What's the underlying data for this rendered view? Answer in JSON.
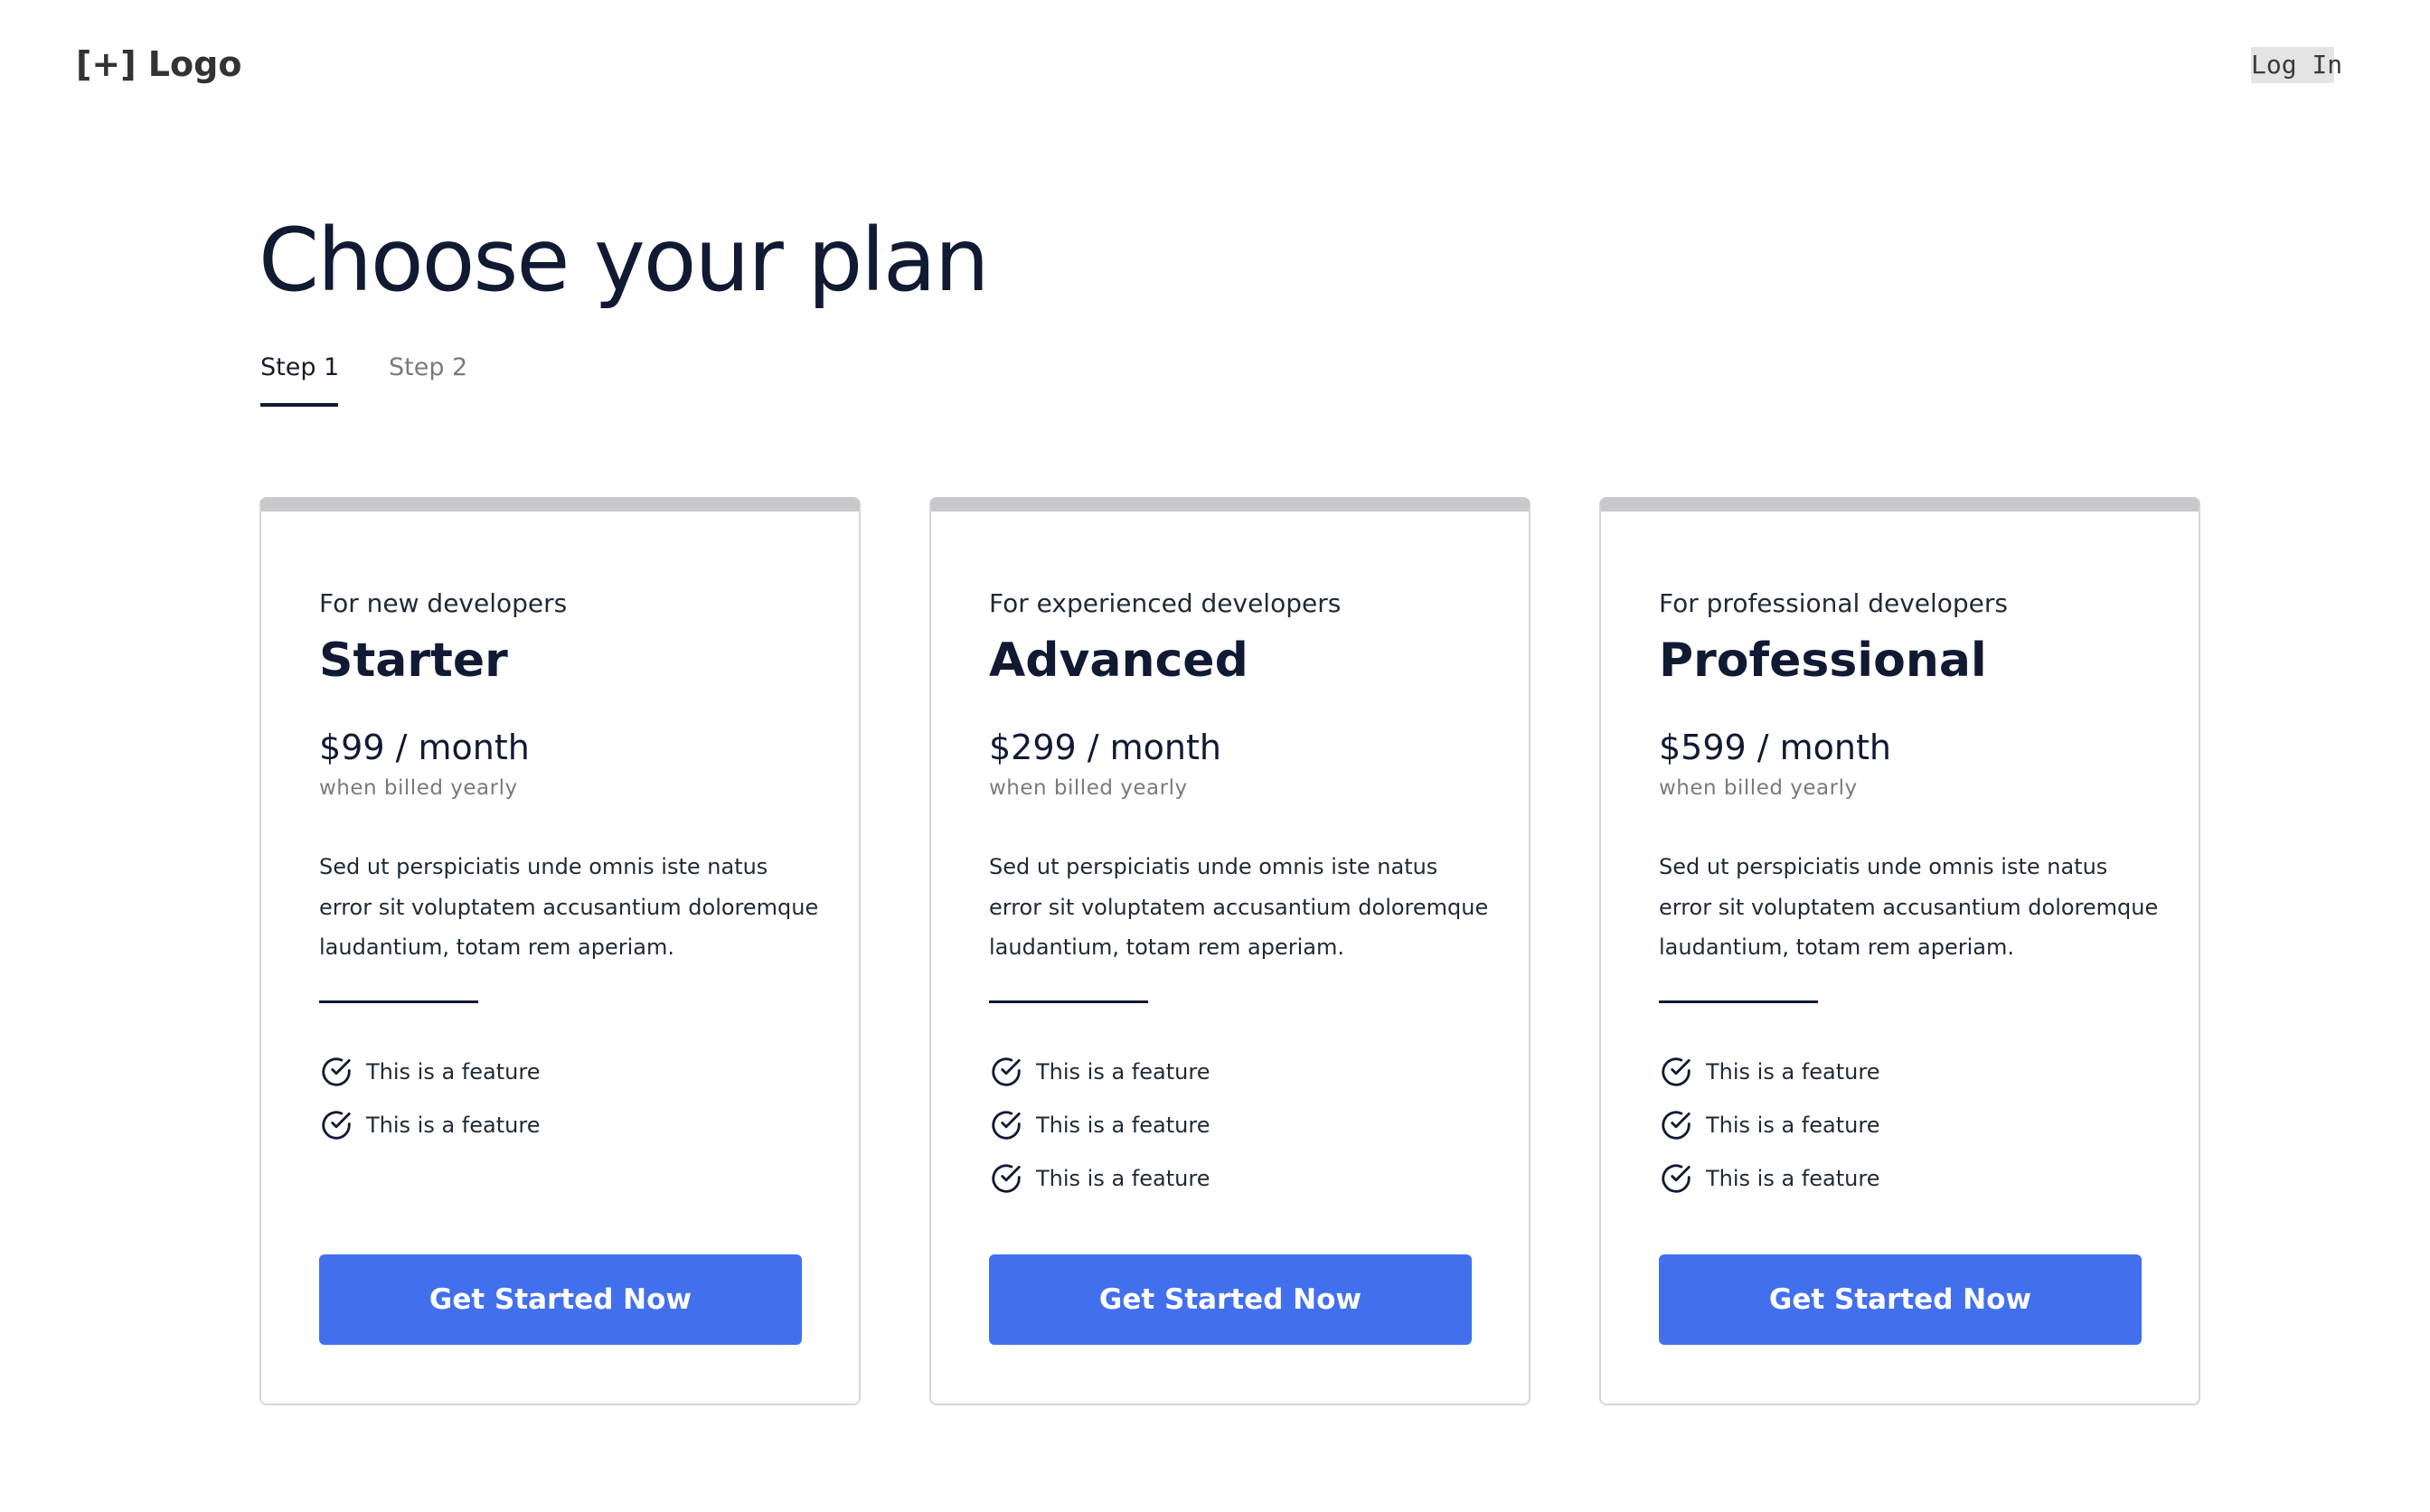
{
  "header": {
    "logo_text": "[+] Logo",
    "login_label": "Log In"
  },
  "main": {
    "title": "Choose your plan",
    "tabs": [
      {
        "label": "Step 1",
        "active": true
      },
      {
        "label": "Step 2",
        "active": false
      }
    ]
  },
  "plans": [
    {
      "audience": "For new developers",
      "name": "Starter",
      "price": "$99 / month",
      "billing": "when billed yearly",
      "description": "Sed ut perspiciatis unde omnis iste natus error sit voluptatem accusantium doloremque laudantium, totam rem aperiam.",
      "features": [
        "This is a feature",
        "This is a feature"
      ],
      "cta": "Get Started Now"
    },
    {
      "audience": "For experienced developers",
      "name": "Advanced",
      "price": "$299 / month",
      "billing": "when billed yearly",
      "description": "Sed ut perspiciatis unde omnis iste natus error sit voluptatem accusantium doloremque laudantium, totam rem aperiam.",
      "features": [
        "This is a feature",
        "This is a feature",
        "This is a feature"
      ],
      "cta": "Get Started Now"
    },
    {
      "audience": "For professional developers",
      "name": "Professional",
      "price": "$599 / month",
      "billing": "when billed yearly",
      "description": "Sed ut perspiciatis unde omnis iste natus error sit voluptatem accusantium doloremque laudantium, totam rem aperiam.",
      "features": [
        "This is a feature",
        "This is a feature",
        "This is a feature"
      ],
      "cta": "Get Started Now"
    }
  ],
  "icons": {
    "feature": "check-circle-icon"
  },
  "colors": {
    "accent": "#4270ed",
    "heading": "#111a33",
    "card_top_bar": "#c9c9cb",
    "muted": "#7a7a7a"
  }
}
